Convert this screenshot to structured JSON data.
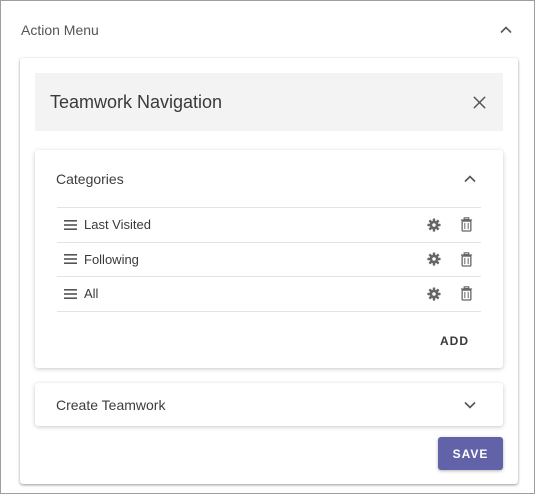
{
  "action_menu": {
    "title": "Action Menu",
    "toggle_icon": "chevron-up-icon"
  },
  "teamwork_nav": {
    "title": "Teamwork Navigation",
    "close_icon": "close-icon"
  },
  "categories": {
    "title": "Categories",
    "toggle_icon": "chevron-up-icon",
    "items": [
      {
        "label": "Last Visited"
      },
      {
        "label": "Following"
      },
      {
        "label": "All"
      }
    ],
    "add_label": "ADD"
  },
  "create_teamwork": {
    "title": "Create Teamwork",
    "toggle_icon": "chevron-down-icon"
  },
  "save_label": "SAVE",
  "colors": {
    "accent": "#6262a8",
    "icon_gray": "#666666",
    "header_bg": "#f3f3f3"
  }
}
